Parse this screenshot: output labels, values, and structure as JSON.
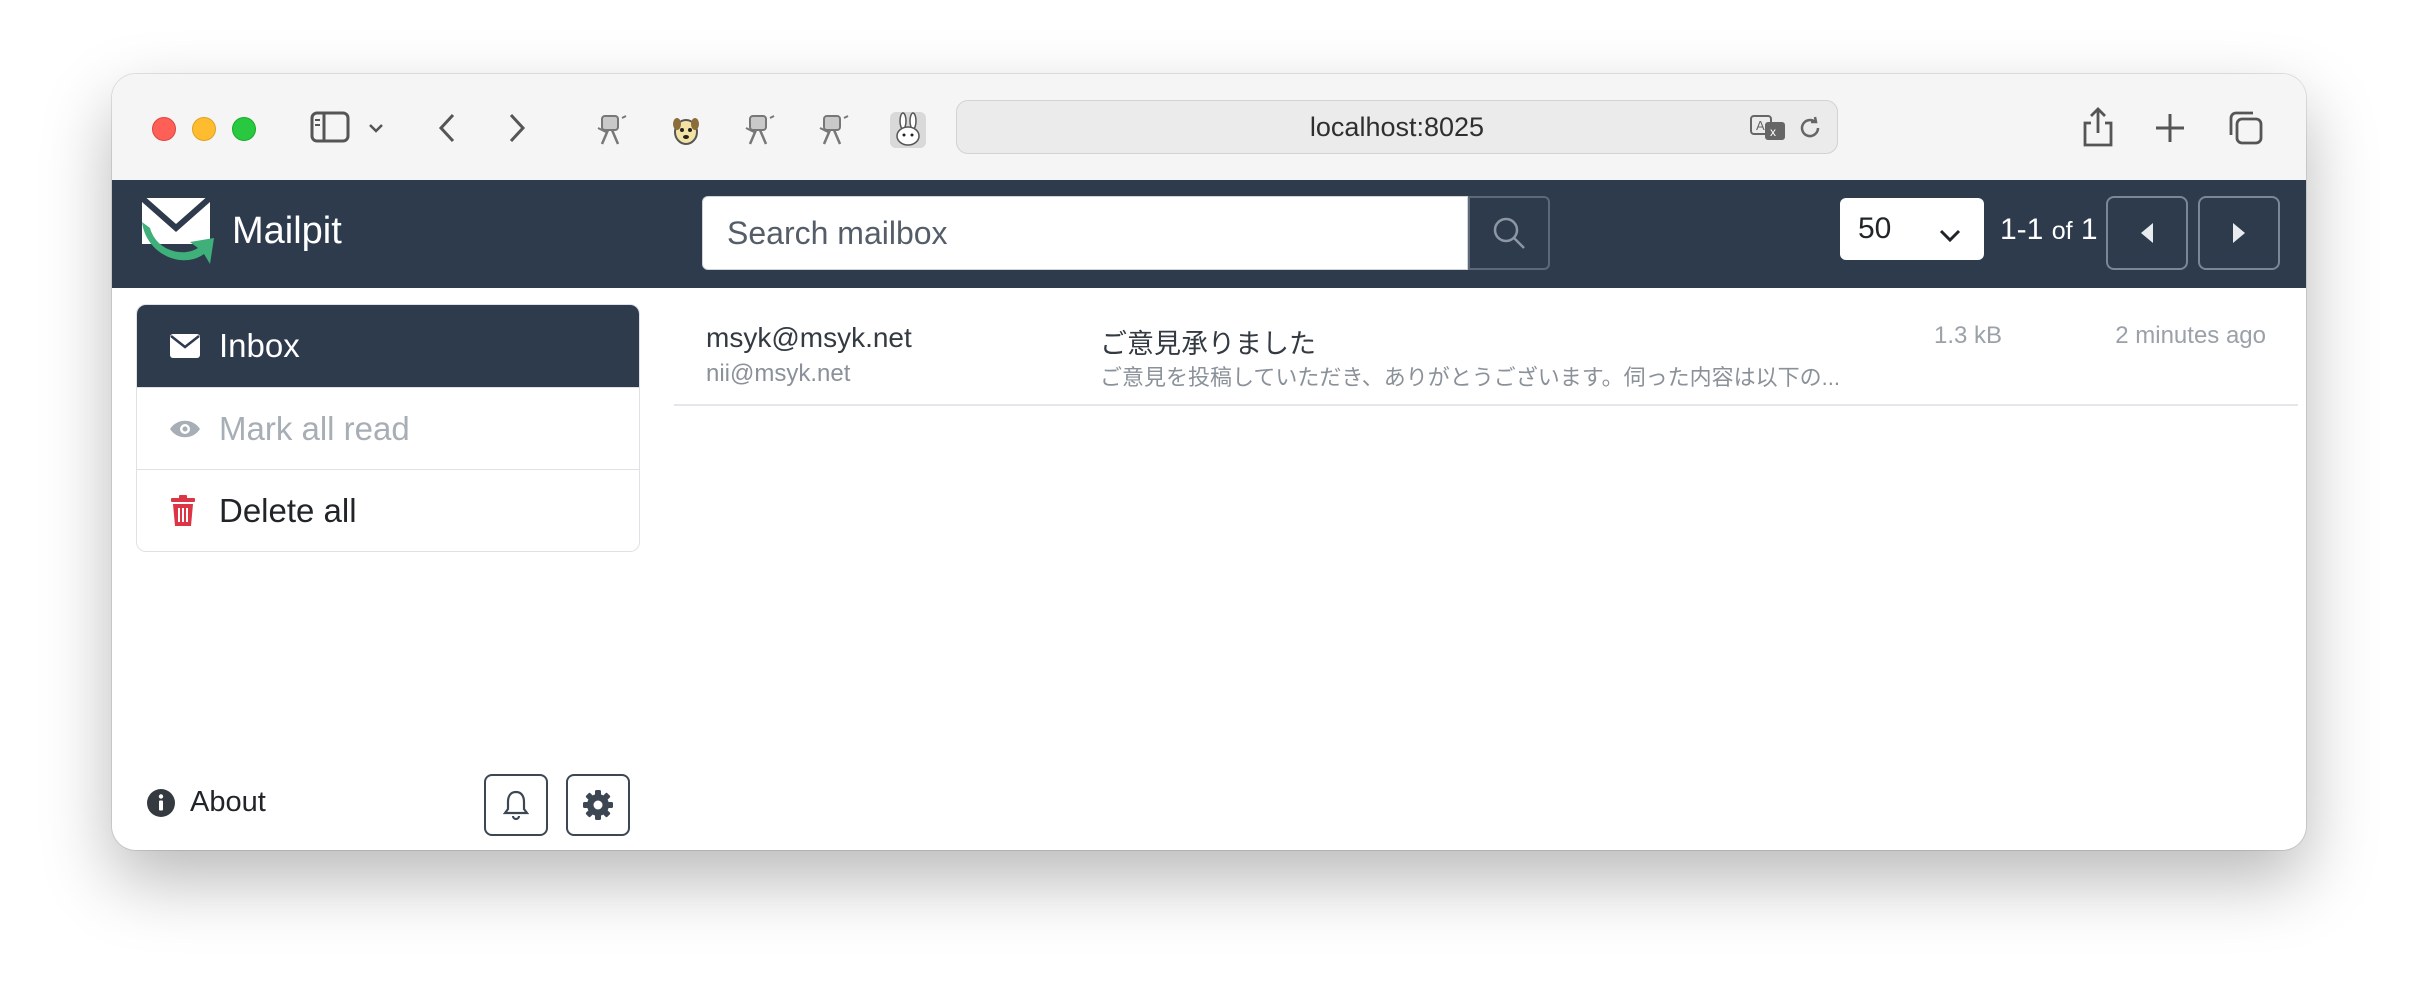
{
  "browser": {
    "url": "localhost:8025",
    "favicons": [
      "bot-favicon-1",
      "dog-favicon",
      "bot-favicon-2",
      "bot-favicon-3",
      "rabbit-favicon"
    ]
  },
  "app": {
    "name": "Mailpit",
    "search_placeholder": "Search mailbox",
    "per_page": "50",
    "pagination": {
      "range": "1-1",
      "of": "of",
      "total": "1"
    }
  },
  "sidebar": {
    "items": [
      {
        "label": "Inbox",
        "icon": "envelope-icon"
      },
      {
        "label": "Mark all read",
        "icon": "eye-icon"
      },
      {
        "label": "Delete all",
        "icon": "trash-icon"
      }
    ],
    "about": "About"
  },
  "messages": [
    {
      "from": "msyk@msyk.net",
      "to": "nii@msyk.net",
      "subject": "ご意見承りました",
      "snippet": "ご意見を投稿していただき、ありがとうございます。伺った内容は以下の...",
      "size": "1.3 kB",
      "date": "2 minutes ago"
    }
  ],
  "colors": {
    "navbar": "#2d3b4d",
    "accent_green": "#3fb07a",
    "danger": "#dc3545"
  }
}
